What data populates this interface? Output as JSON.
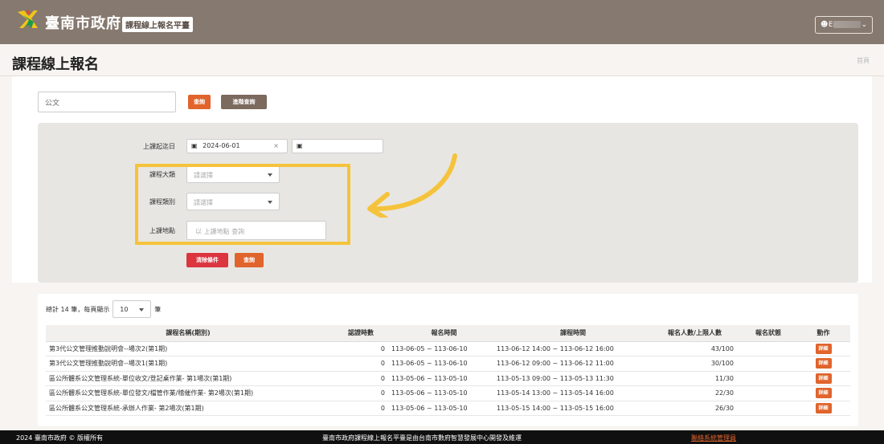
{
  "header": {
    "brand": "臺南市政府",
    "subtitle": "課程線上報名平臺",
    "user_initial": "E",
    "user_icon": "person-icon",
    "colors": {
      "bar": "#86796f",
      "accent": "#e0642c"
    }
  },
  "page": {
    "title": "課程線上報名",
    "breadcrumb_home": "首頁"
  },
  "search": {
    "value": "公文",
    "query_button": "查詢",
    "advanced_button": "進階查詢"
  },
  "filters": {
    "date_label": "上課起迄日",
    "date_start": "2024-06-01",
    "date_sep": "~",
    "category_label": "課程大類",
    "category_placeholder": "請選擇",
    "type_label": "課程類別",
    "type_placeholder": "請選擇",
    "location_label": "上課地點",
    "location_placeholder": "以 上課地點 查詢",
    "clear_button": "清除條件",
    "submit_button": "查詢"
  },
  "results": {
    "summary_prefix": "總計 14 筆，每頁顯示",
    "page_size": "10",
    "summary_suffix": "筆",
    "columns": [
      "課程名稱(期別)",
      "認證時數",
      "報名時間",
      "課程時間",
      "報名人數/上限人數",
      "報名狀態",
      "動作"
    ],
    "rows": [
      {
        "name": "第3代公文管理推動說明會--場次2(第1期)",
        "hours": "0",
        "signup": "113-06-05 ~ 113-06-10",
        "course": "113-06-12 14:00 ~ 113-06-12 16:00",
        "count": "43/100",
        "status": "",
        "action": "詳細"
      },
      {
        "name": "第3代公文管理推動說明會--場次1(第1期)",
        "hours": "0",
        "signup": "113-06-05 ~ 113-06-10",
        "course": "113-06-12 09:00 ~ 113-06-12 11:00",
        "count": "30/100",
        "status": "",
        "action": "詳細"
      },
      {
        "name": "區公所體系公文管理系統-單位收文/登記桌作業- 第1場次(第1期)",
        "hours": "0",
        "signup": "113-05-06 ~ 113-05-10",
        "course": "113-05-13 09:00 ~ 113-05-13 11:30",
        "count": "11/30",
        "status": "",
        "action": "詳細"
      },
      {
        "name": "區公所體系公文管理系統-單位發文/檔管作業/稽催作業- 第2場次(第1期)",
        "hours": "0",
        "signup": "113-05-06 ~ 113-05-10",
        "course": "113-05-14 13:00 ~ 113-05-14 16:00",
        "count": "22/30",
        "status": "",
        "action": "詳細"
      },
      {
        "name": "區公所體系公文管理系統-承辦人作業- 第2場次(第1期)",
        "hours": "0",
        "signup": "113-05-06 ~ 113-05-10",
        "course": "113-05-15 14:00 ~ 113-05-15 16:00",
        "count": "26/30",
        "status": "",
        "action": "詳細"
      }
    ]
  },
  "footer": {
    "copyright": "2024 臺南市政府 © 版權所有",
    "credit": "臺南市政府課程線上報名平臺是由台南市數府智慧發展中心開發及維運",
    "contact": "聯絡系統管理員"
  }
}
